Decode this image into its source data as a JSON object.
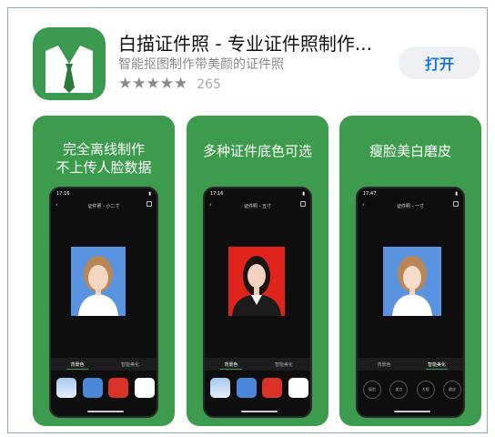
{
  "app": {
    "title": "白描证件照 - 专业证件照制作...",
    "subtitle": "智能抠图制作带美颜的证件照",
    "stars": "★★★★★",
    "rating_count": "265",
    "get_label": "打开",
    "icon": "white-shirt-collar-green-tie-icon",
    "accent_color": "#1a73e8",
    "brand_color": "#3b9a4f"
  },
  "screenshots": [
    {
      "caption_line1": "完全离线制作",
      "caption_line2": "不上传人脸数据",
      "time": "17:16",
      "nav_title": "证件照 - 小二寸",
      "photo_bg": "#5a93e0",
      "tabs": [
        "背景色",
        "智能美化"
      ],
      "active_tab": 0,
      "swatches": [
        "#bcd6f3",
        "#4a87d9",
        "#d93328",
        "#ffffff"
      ]
    },
    {
      "caption_line1": "多种证件底色可选",
      "caption_line2": "",
      "time": "17:16",
      "nav_title": "证件照 - 五寸",
      "photo_bg": "#e0241c",
      "tabs": [
        "背景色",
        "智能美化"
      ],
      "active_tab": 0,
      "swatches": [
        "#bcd6f3",
        "#4a87d9",
        "#d93328",
        "#ffffff"
      ]
    },
    {
      "caption_line1": "瘦脸美白磨皮",
      "caption_line2": "",
      "time": "17:47",
      "nav_title": "证件照 - 一寸",
      "photo_bg": "#5a93e0",
      "tabs": [
        "背景色",
        "智能美化"
      ],
      "active_tab": 1,
      "beauty_options": [
        "瘦脸",
        "美白",
        "大眼",
        "磨皮"
      ]
    }
  ]
}
